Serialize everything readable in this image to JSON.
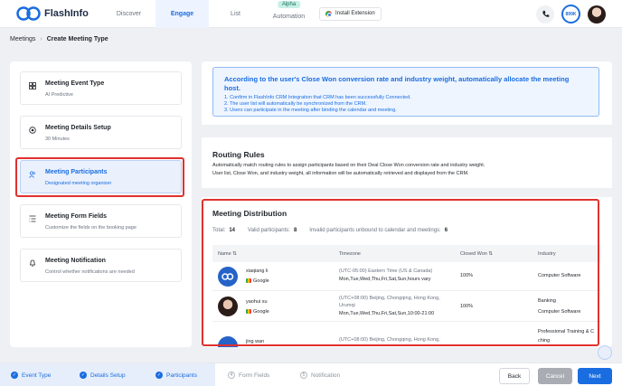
{
  "brand": {
    "name": "FlashInfo"
  },
  "nav": {
    "items": [
      {
        "label": "Discover"
      },
      {
        "label": "Engage"
      },
      {
        "label": "List"
      },
      {
        "label": "Automation",
        "badge": "Alpha"
      }
    ],
    "install_extension": "Install Extension",
    "credits": "899K"
  },
  "breadcrumb": {
    "root": "Meetings",
    "separator": "›",
    "current": "Create Meeting Type"
  },
  "steps": [
    {
      "title": "Meeting Event Type",
      "subtitle": "AI Predictive",
      "icon": "grid-icon"
    },
    {
      "title": "Meeting Details Setup",
      "subtitle": "30 Minutes",
      "icon": "target-icon"
    },
    {
      "title": "Meeting Participants",
      "subtitle": "Designated meeting organizer",
      "icon": "people-icon"
    },
    {
      "title": "Meeting Form Fields",
      "subtitle": "Customize the fields on the booking page",
      "icon": "form-icon"
    },
    {
      "title": "Meeting Notification",
      "subtitle": "Control whether notifications are needed",
      "icon": "bell-icon"
    }
  ],
  "info": {
    "title": "According to the user's Close Won conversion rate and industry weight, automatically allocate the meeting host.",
    "lines": [
      "1. Confirm in FlashInfo CRM Integration that CRM has been successfully Connected.",
      "2. The user list will automatically be synchronized from the CRM.",
      "3. Users can participate in the meeting after binding the calendar and meeting."
    ]
  },
  "routing": {
    "title": "Routing Rules",
    "desc1": "Automatically match routing rules to assign participants based on their Deal Close Won conversion rate and industry weight.",
    "desc2": "User list, Close Won, and industry weight, all information will be automatically retrieved and displayed from the CRM."
  },
  "distribution": {
    "title": "Meeting Distribution",
    "total_label": "Total:",
    "total": "14",
    "valid_label": "Valid participants:",
    "valid": "8",
    "invalid_label": "Invalid participants unbound to calendar and meetings:",
    "invalid": "6",
    "columns": [
      "Name",
      "Timezone",
      "Closed Won",
      "Industry"
    ],
    "rows": [
      {
        "name": "xiaqiang li",
        "meeting": "Google",
        "tz1": "(UTC-05:00) Eastern Time (US & Canada)",
        "tz2": "Mon,Tue,Wed,Thu,Fri,Sat,Sun,hours vary",
        "closed_won": "100%",
        "industry1": "Computer Software",
        "industry2": ""
      },
      {
        "name": "yaohui xu",
        "meeting": "Google",
        "tz1": "(UTC+08:00) Beijing, Chongqing, Hong Kong,",
        "tz1b": "Urumqi",
        "tz2": "Mon,Tue,Wed,Thu,Fri,Sat,Sun,10:00-21:00",
        "closed_won": "100%",
        "industry1": "Banking",
        "industry2": "Computer Software"
      },
      {
        "name": "jing wan",
        "meeting": "",
        "tz1": "(UTC+08:00) Beijing, Chongqing, Hong Kong,",
        "closed_won": "",
        "industry1": "Professional Training & C",
        "industry2": "ching"
      }
    ]
  },
  "bottom_steps": [
    {
      "label": "Event Type",
      "state": "done"
    },
    {
      "label": "Details Setup",
      "state": "done"
    },
    {
      "label": "Participants",
      "state": "current"
    },
    {
      "num": "4",
      "label": "Form Fields",
      "state": "pending"
    },
    {
      "num": "5",
      "label": "Notification",
      "state": "pending"
    }
  ],
  "buttons": {
    "back": "Back",
    "cancel": "Cancel",
    "next": "Next"
  },
  "colors": {
    "accent": "#1a6de0",
    "highlight": "#e0312f"
  }
}
